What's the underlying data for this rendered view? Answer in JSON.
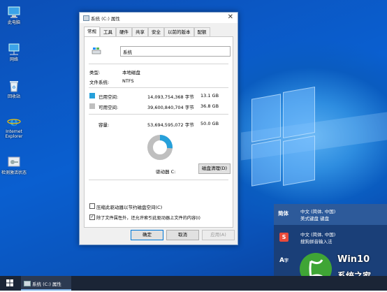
{
  "desktop": {
    "icons": [
      {
        "label": "此电脑",
        "icon": "computer-icon"
      },
      {
        "label": "网络",
        "icon": "network-icon"
      },
      {
        "label": "回收站",
        "icon": "recycle-bin-icon"
      },
      {
        "label": "Internet Explorer",
        "icon": "ie-icon"
      },
      {
        "label": "检测激活状态",
        "icon": "activation-icon"
      }
    ]
  },
  "window": {
    "title": "系统 (C:) 属性",
    "close_glyph": "✕",
    "tabs": [
      "常规",
      "工具",
      "硬件",
      "共享",
      "安全",
      "以前的版本",
      "配额"
    ],
    "active_tab": "常规",
    "drive_name": "系统",
    "type_label": "类型:",
    "type_value": "本地磁盘",
    "fs_label": "文件系统:",
    "fs_value": "NTFS",
    "used_label": "已用空间:",
    "used_bytes": "14,093,754,368 字节",
    "used_gb": "13.1 GB",
    "free_label": "可用空间:",
    "free_bytes": "39,600,840,704 字节",
    "free_gb": "36.8 GB",
    "capacity_label": "容量:",
    "capacity_bytes": "53,694,595,072 字节",
    "capacity_gb": "50.0 GB",
    "used_fraction": 0.262,
    "drive_label": "驱动器 C:",
    "cleanup_button": "磁盘清理(D)",
    "compress_label": "压缩此驱动器以节约磁盘空间(C)",
    "compress_checked": false,
    "index_label": "除了文件属性外，还允许索引此驱动器上文件的内容(I)",
    "index_checked": true,
    "ok_button": "确定",
    "cancel_button": "取消",
    "apply_button": "应用(A)",
    "colors": {
      "used": "#26a0da",
      "free": "#bfbfbf"
    }
  },
  "ime": {
    "items": [
      {
        "code": "简体",
        "line1": "中文 (简体, 中国)",
        "line2": "美式键盘 键盘"
      },
      {
        "code": "S",
        "line1": "中文 (简体, 中国)",
        "line2": "搜狗拼音输入法"
      }
    ]
  },
  "taskbar": {
    "start_icon": "windows-logo-icon",
    "active_task": "系统 (C:) 属性"
  },
  "watermark": {
    "brand": "Win10",
    "subtitle": "系统之家"
  }
}
